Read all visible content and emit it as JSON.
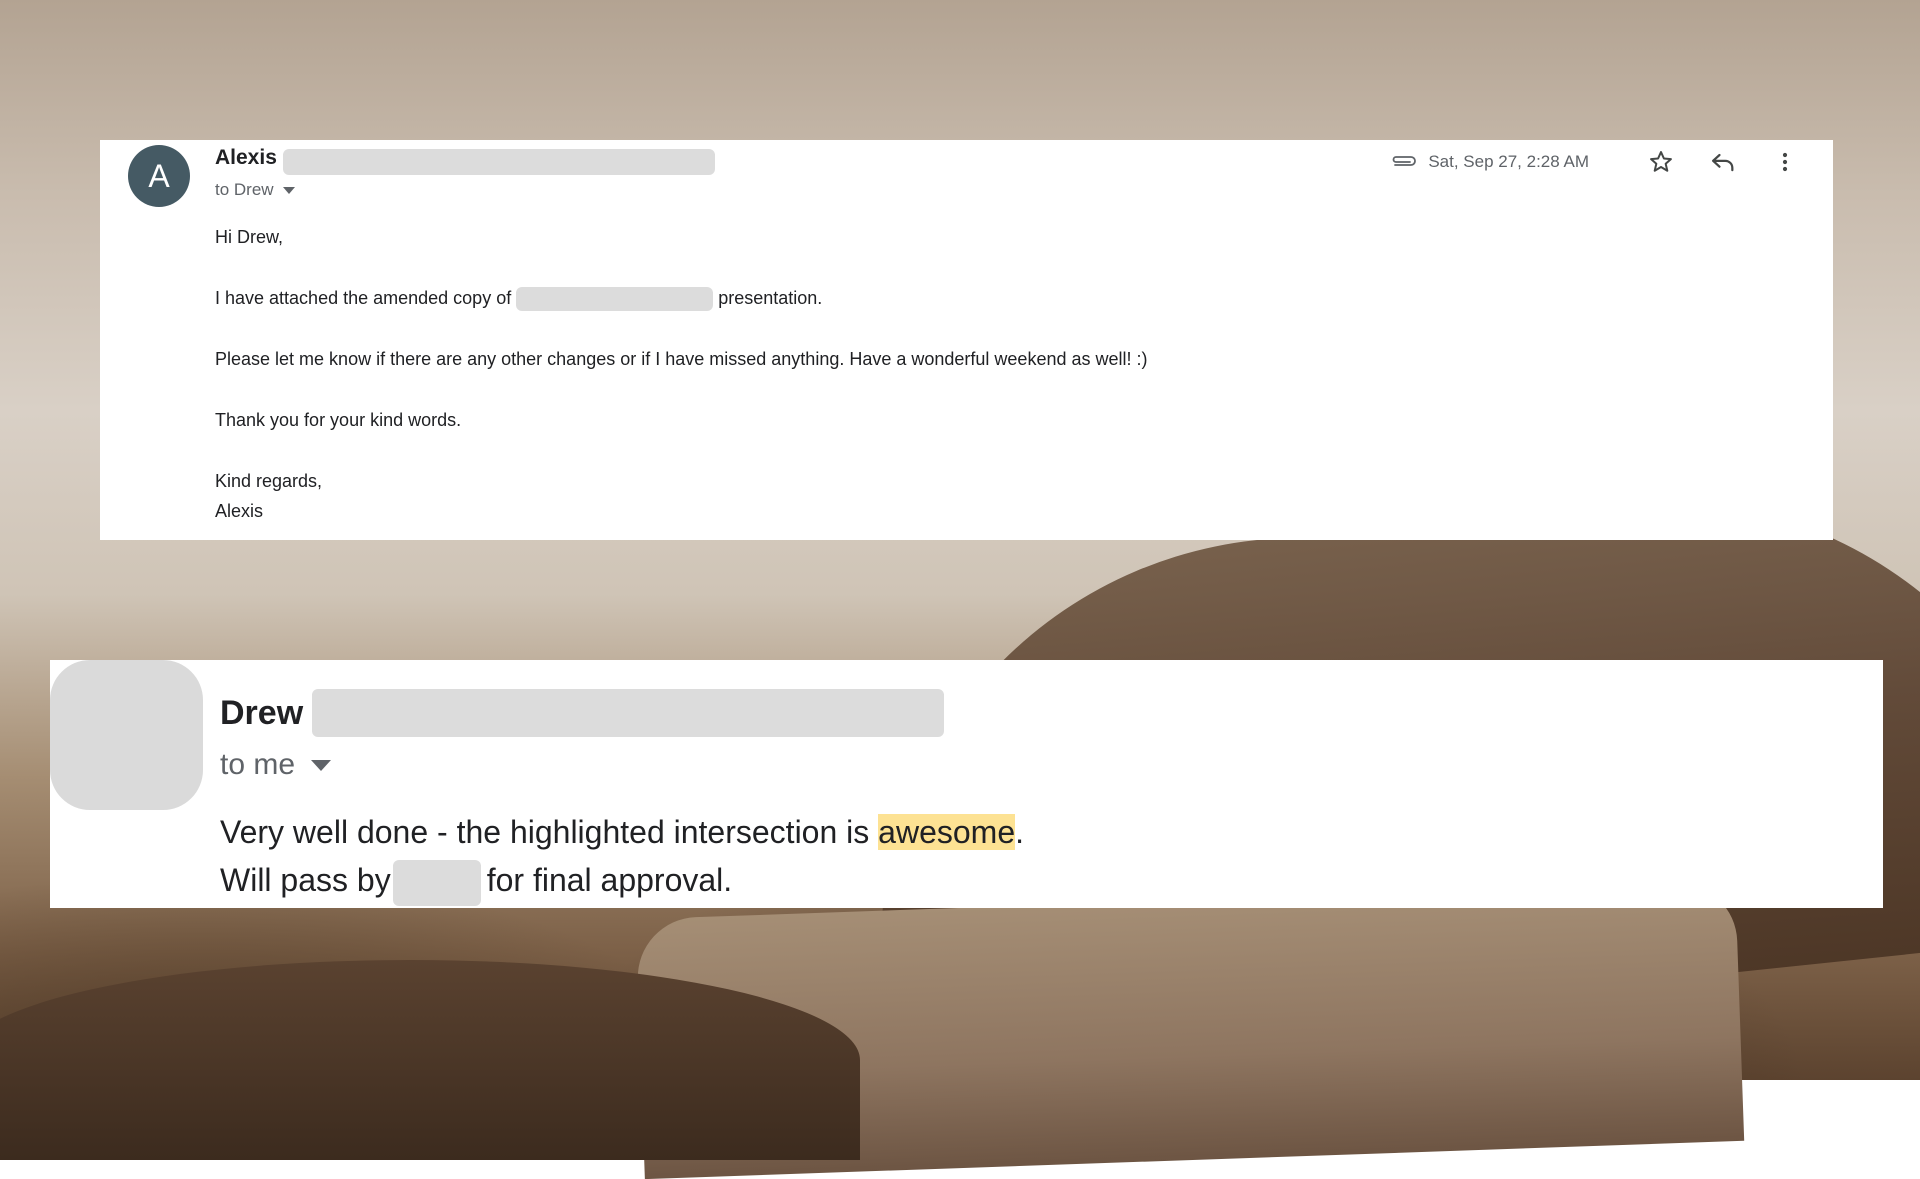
{
  "email1": {
    "avatar_letter": "A",
    "sender": "Alexis",
    "recipient_line": "to Drew",
    "date": "Sat, Sep 27, 2:28 AM",
    "greeting": "Hi Drew,",
    "line1_before": "I have attached the amended copy of",
    "line1_after": "presentation.",
    "line2": "Please let me know if there are any other changes or if I have missed anything. Have a wonderful weekend as well! :)",
    "line3": "Thank you for your kind words.",
    "closing": "Kind regards,",
    "signature": "Alexis",
    "icons": [
      "paperclip-icon",
      "star-icon",
      "reply-icon",
      "more-vert-icon"
    ]
  },
  "email2": {
    "sender": "Drew",
    "recipient_line": "to me",
    "line1_before": "Very well done - the highlighted intersection is",
    "line1_highlight": "awesome",
    "line1_after": ".",
    "line2_before": "Will pass by",
    "line2_after": "for final approval.",
    "highlight_color": "#fde293"
  },
  "colors": {
    "avatar1": "#455a64",
    "redaction": "#dcdcdc",
    "text": "#202124",
    "secondary_text": "#5f6368"
  }
}
